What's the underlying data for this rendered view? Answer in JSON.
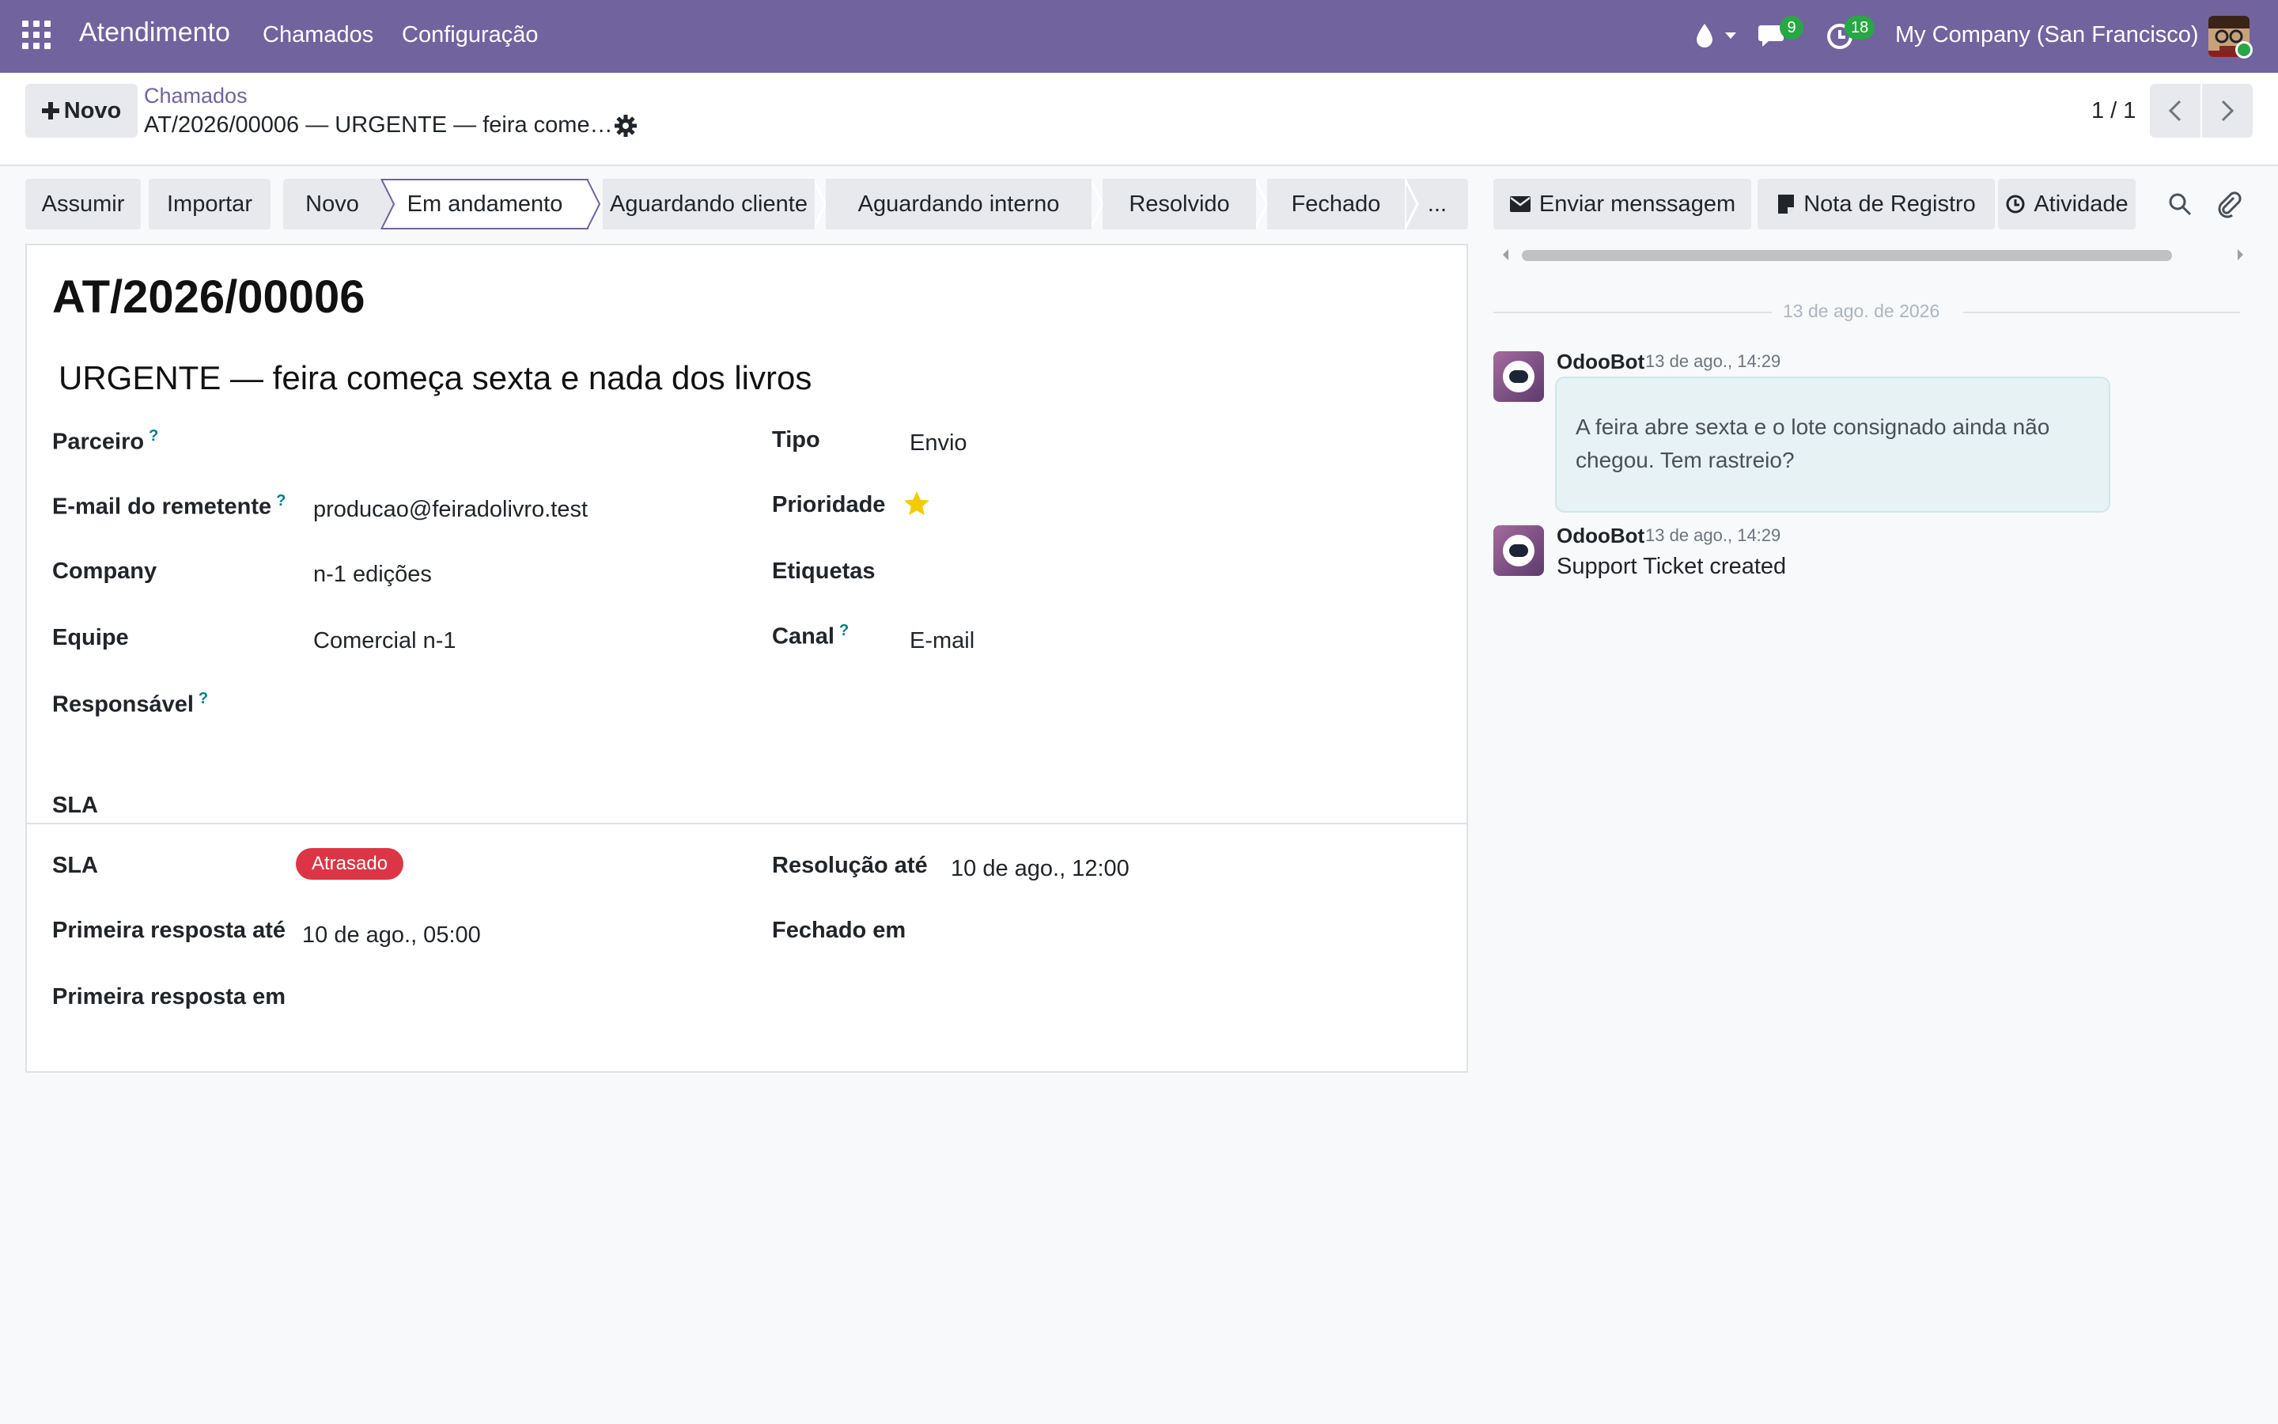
{
  "navbar": {
    "app_name": "Atendimento",
    "menu": [
      "Chamados",
      "Configuração"
    ],
    "messages_count": "9",
    "activities_count": "18",
    "company": "My Company (San Francisco)"
  },
  "control_panel": {
    "new_label": "Novo",
    "breadcrumb_parent": "Chamados",
    "breadcrumb_current": "AT/2026/00006 — URGENTE — feira come…",
    "pager": "1 / 1"
  },
  "statusbar": {
    "actions": [
      "Assumir",
      "Importar"
    ],
    "stages": [
      "Novo",
      "Em andamento",
      "Aguardando cliente",
      "Aguardando interno",
      "Resolvido",
      "Fechado",
      "..."
    ],
    "active_stage": "Em andamento"
  },
  "form": {
    "name": "AT/2026/00006",
    "subject": "URGENTE — feira começa sexta e nada dos livros",
    "help_mark": "?",
    "fields_left": [
      {
        "label": "Parceiro",
        "value": "",
        "help": true
      },
      {
        "label": "E-mail do remetente",
        "value": "producao@feiradolivro.test",
        "help": true
      },
      {
        "label": "Company",
        "value": "n-1 edições",
        "help": false
      },
      {
        "label": "Equipe",
        "value": "Comercial n-1",
        "help": false
      },
      {
        "label": "Responsável",
        "value": "",
        "help": true
      }
    ],
    "fields_right": [
      {
        "label": "Tipo",
        "value": "Envio",
        "help": false
      },
      {
        "label": "Prioridade",
        "value": "",
        "help": false
      },
      {
        "label": "Etiquetas",
        "value": "",
        "help": false
      },
      {
        "label": "Canal",
        "value": "E-mail",
        "help": true
      }
    ],
    "priority_stars": 1,
    "sla": {
      "heading": "SLA",
      "sla_label": "SLA",
      "sla_status": "Atrasado",
      "first_response_until_label": "Primeira resposta até",
      "first_response_until_value": "10 de ago., 05:00",
      "first_response_at_label": "Primeira resposta em",
      "resolution_until_label": "Resolução até",
      "resolution_until_value": "10 de ago., 12:00",
      "closed_at_label": "Fechado em"
    }
  },
  "chatter": {
    "send_message": "Enviar menssagem",
    "log_note": "Nota de Registro",
    "activity": "Atividade",
    "date_separator": "13 de ago. de 2026",
    "messages": [
      {
        "author": "OdooBot",
        "date": "13 de ago., 14:29",
        "lines": [
          "A feira abre sexta e o lote consignado ainda não",
          "chegou. Tem rastreio?"
        ]
      },
      {
        "author": "OdooBot",
        "date": "13 de ago., 14:29",
        "text": "Support Ticket created"
      }
    ]
  },
  "colors": {
    "brand": "#71639e",
    "badge": "#28a745",
    "danger": "#dc3545",
    "star": "#f3cc00",
    "help": "#017e84"
  }
}
